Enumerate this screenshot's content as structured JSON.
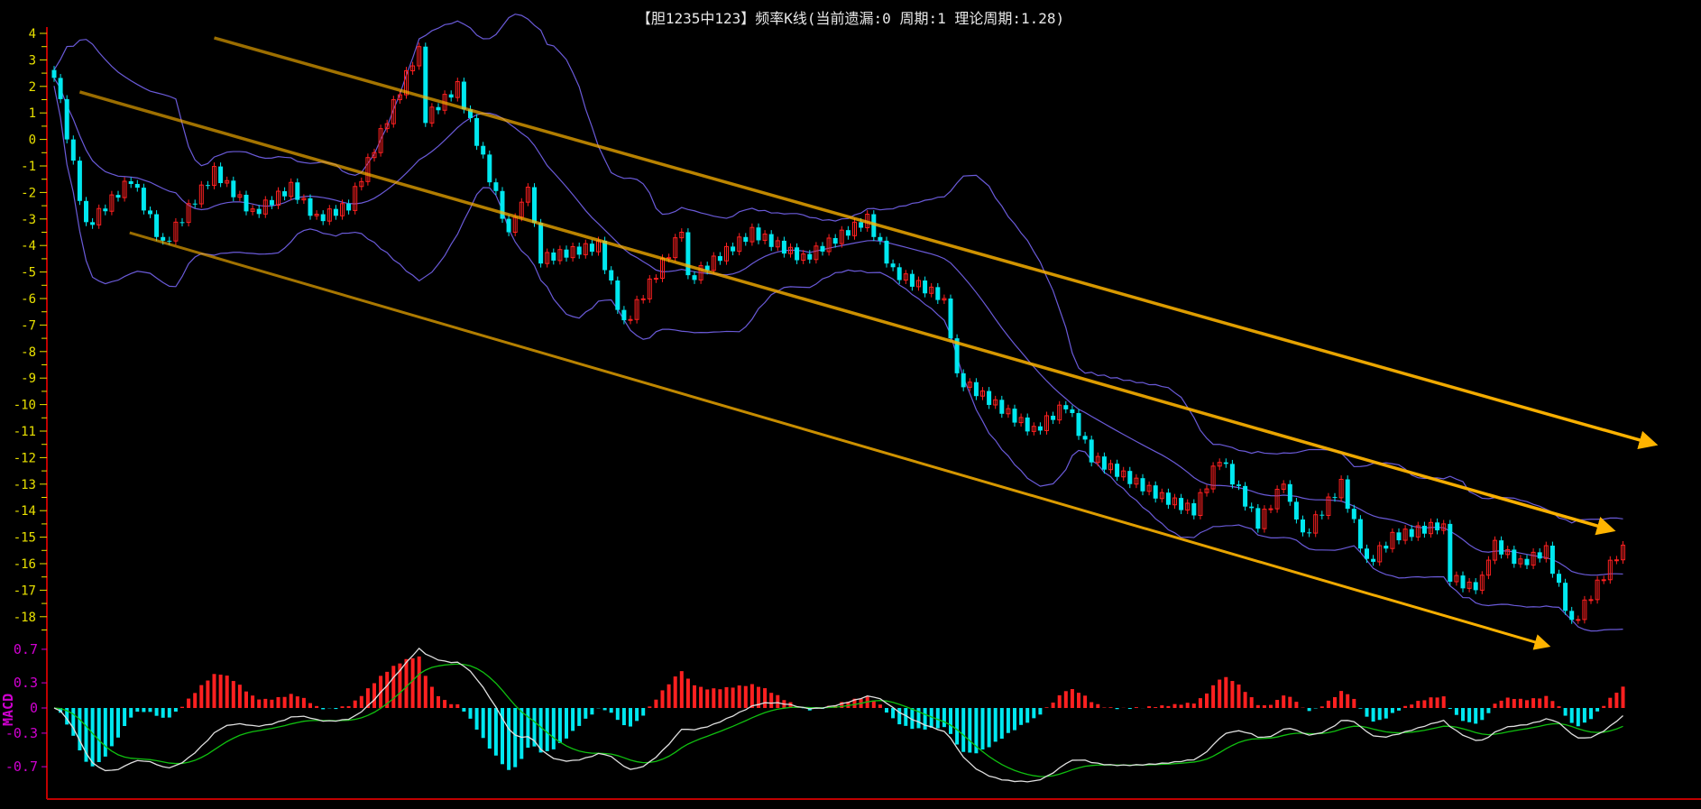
{
  "title": "【胆1235中123】频率K线(当前遗漏:0 周期:1 理论周期:1.28)",
  "chart_data": {
    "type": "candlestick",
    "title": "【胆1235中123】频率K线(当前遗漏:0 周期:1 理论周期:1.28)",
    "ylim": [
      -18,
      4
    ],
    "yticks": [
      "4",
      "3",
      "2",
      "1",
      "0",
      "-1",
      "-2",
      "-3",
      "-4",
      "-5",
      "-6",
      "-7",
      "-8",
      "-9",
      "-10",
      "-11",
      "-12",
      "-13",
      "-14",
      "-15",
      "-16",
      "-17",
      "-18"
    ],
    "bar_count": 246,
    "close_waypoints": [
      [
        0,
        2.5
      ],
      [
        5,
        -3.3
      ],
      [
        12,
        -1.5
      ],
      [
        17,
        -4
      ],
      [
        25,
        -1.2
      ],
      [
        31,
        -2.8
      ],
      [
        37,
        -1.8
      ],
      [
        41,
        -3
      ],
      [
        46,
        -2.5
      ],
      [
        57,
        3.5
      ],
      [
        58,
        0.8
      ],
      [
        63,
        2
      ],
      [
        71,
        -3.5
      ],
      [
        74,
        -1.8
      ],
      [
        76,
        -4.5
      ],
      [
        85,
        -4
      ],
      [
        89,
        -7
      ],
      [
        98,
        -3.5
      ],
      [
        99,
        -5.3
      ],
      [
        109,
        -3.5
      ],
      [
        117,
        -4.5
      ],
      [
        127,
        -3
      ],
      [
        131,
        -5
      ],
      [
        139,
        -6
      ],
      [
        141,
        -9
      ],
      [
        153,
        -11
      ],
      [
        158,
        -10
      ],
      [
        162,
        -12
      ],
      [
        173,
        -13.5
      ],
      [
        178,
        -14
      ],
      [
        182,
        -12
      ],
      [
        188,
        -14.5
      ],
      [
        192,
        -13
      ],
      [
        195,
        -15
      ],
      [
        201,
        -13
      ],
      [
        205,
        -16
      ],
      [
        209,
        -15
      ],
      [
        217,
        -14.5
      ],
      [
        218,
        -16.5
      ],
      [
        222,
        -17
      ],
      [
        225,
        -15.3
      ],
      [
        229,
        -16
      ],
      [
        233,
        -15.5
      ],
      [
        237,
        -18.3
      ],
      [
        245,
        -15.3
      ]
    ],
    "trend_lines": [
      {
        "from": [
          25,
          3.83
        ],
        "to": [
          250,
          -11.5
        ],
        "style": "upper"
      },
      {
        "from": [
          4,
          1.79
        ],
        "to": [
          243.4,
          -14.74
        ],
        "style": "middle"
      },
      {
        "from": [
          11.8,
          -3.52
        ],
        "to": [
          233.3,
          -19.1
        ],
        "style": "lower"
      }
    ],
    "indicators": {
      "bollinger": "20,2",
      "macd": "12,26,9"
    },
    "macd_panel": {
      "label": "MACD",
      "yticks": [
        "0.7",
        "0.3",
        "0",
        "-0.3",
        "-0.7"
      ],
      "ylim": [
        -0.9,
        0.9
      ]
    },
    "colors": {
      "up": "#ff2020",
      "down": "#00e8f0",
      "boll": "#6a5ad8",
      "trend": "#ffb400",
      "dif": "#e0e0e0",
      "dea": "#10c010",
      "axis": "#c00000"
    }
  }
}
